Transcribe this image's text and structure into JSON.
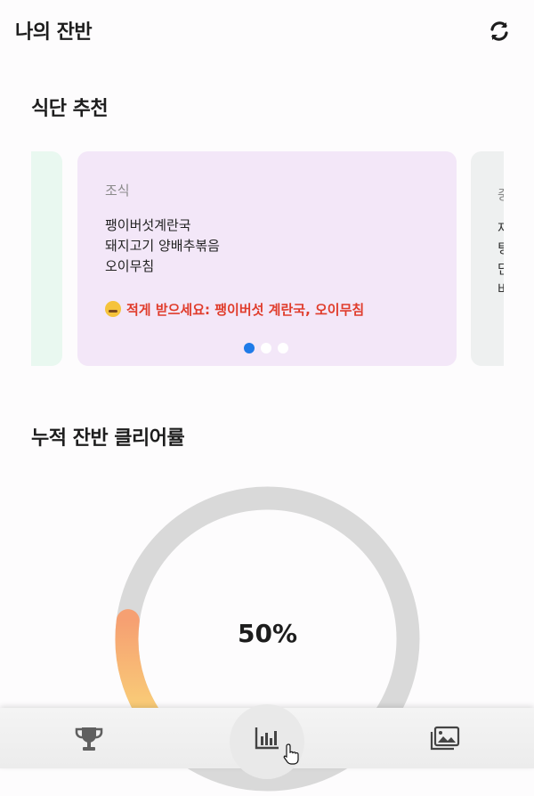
{
  "header": {
    "title": "나의 잔반",
    "refresh_icon": "refresh-icon"
  },
  "recommendation": {
    "section_title": "식단 추천",
    "cards": [
      {
        "meal_label": "조식",
        "items": [
          "팽이버섯계란국",
          "돼지고기 양배추볶음",
          "오이무침"
        ],
        "warning_emoji": "confounded-face",
        "warning_text": "적게 받으세요: 팽이버섯 계란국, 오이무침"
      }
    ],
    "next_card_peek": {
      "meal_label": "중",
      "lines": [
        "재",
        "팅",
        "단",
        "버"
      ]
    },
    "pagination": {
      "count": 3,
      "active_index": 0
    },
    "colors": {
      "card_bg": "#f3e7f8",
      "warning": "#e03c2b",
      "dot_active": "#1f7be8"
    }
  },
  "clear_rate": {
    "section_title": "누적 잔반 클리어률",
    "value_label": "50%",
    "value_fraction": 0.5,
    "colors": {
      "track": "#d9d9d9",
      "gradient_start": "#f6a072",
      "gradient_end": "#fbe27a"
    }
  },
  "bottom_nav": {
    "items": [
      {
        "name": "trophy-icon",
        "active": false
      },
      {
        "name": "bar-chart-icon",
        "active": true
      },
      {
        "name": "gallery-icon",
        "active": false
      }
    ]
  }
}
